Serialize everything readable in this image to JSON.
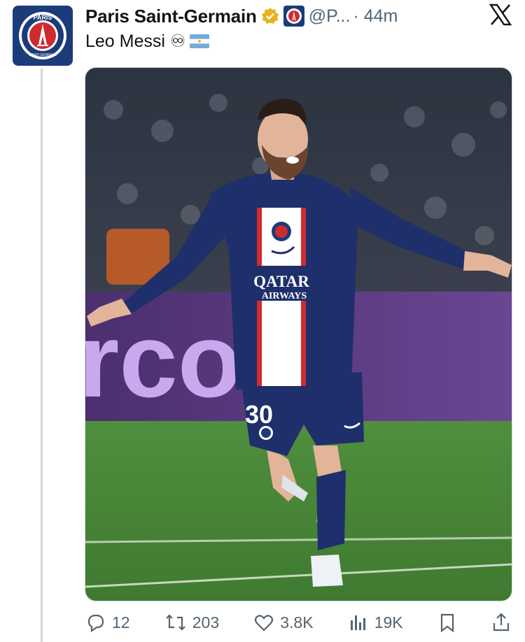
{
  "tweet": {
    "display_name": "Paris Saint-Germain",
    "handle": "@P...",
    "time": "· 44m",
    "text": "Leo Messi ♾",
    "flag_emoji": "argentina-flag",
    "verified_color": "#e8b21e"
  },
  "avatar": {
    "logo_text": "PARIS",
    "logo_subtext": "SAINT-GERMAIN",
    "bg_color": "#1b3b7a"
  },
  "media": {
    "jersey_number": "30",
    "sponsor_line1": "QATAR",
    "sponsor_line2": "AIRWAYS",
    "banner_text": "rcord",
    "pitch_color": "#4b8b3b",
    "kit_color": "#1e2f6b"
  },
  "actions": {
    "replies": "12",
    "reposts": "203",
    "likes": "3.8K",
    "views": "19K"
  },
  "icons": [
    "verified-icon",
    "psg-badge-icon",
    "x-logo-icon",
    "reply-icon",
    "repost-icon",
    "like-icon",
    "views-icon",
    "bookmark-icon",
    "share-icon"
  ]
}
